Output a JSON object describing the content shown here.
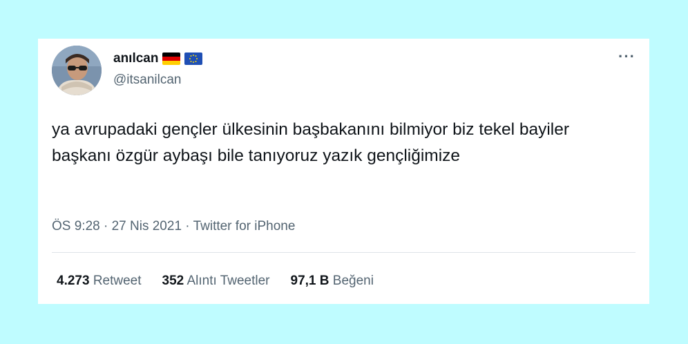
{
  "tweet": {
    "display_name": "anılcan",
    "handle": "@itsanilcan",
    "name_emoji": [
      "german-flag",
      "eu-flag"
    ],
    "text": "ya avrupadaki gençler ülkesinin başbakanını bilmiyor biz tekel bayiler başkanı özgür aybaşı bile tanıyoruz yazık gençliğimize",
    "time": "ÖS 9:28",
    "date": "27 Nis 2021",
    "source": "Twitter for iPhone",
    "separator": "·",
    "more_icon": "more-horizontal-icon",
    "stats": {
      "retweets": {
        "count": "4.273",
        "label": "Retweet"
      },
      "quotes": {
        "count": "352",
        "label": "Alıntı Tweetler"
      },
      "likes": {
        "count": "97,1 B",
        "label": "Beğeni"
      }
    }
  },
  "colors": {
    "background": "#bffcff",
    "card": "#ffffff",
    "text_primary": "#0f1419",
    "text_secondary": "#536471",
    "divider": "#dfe4e8"
  }
}
